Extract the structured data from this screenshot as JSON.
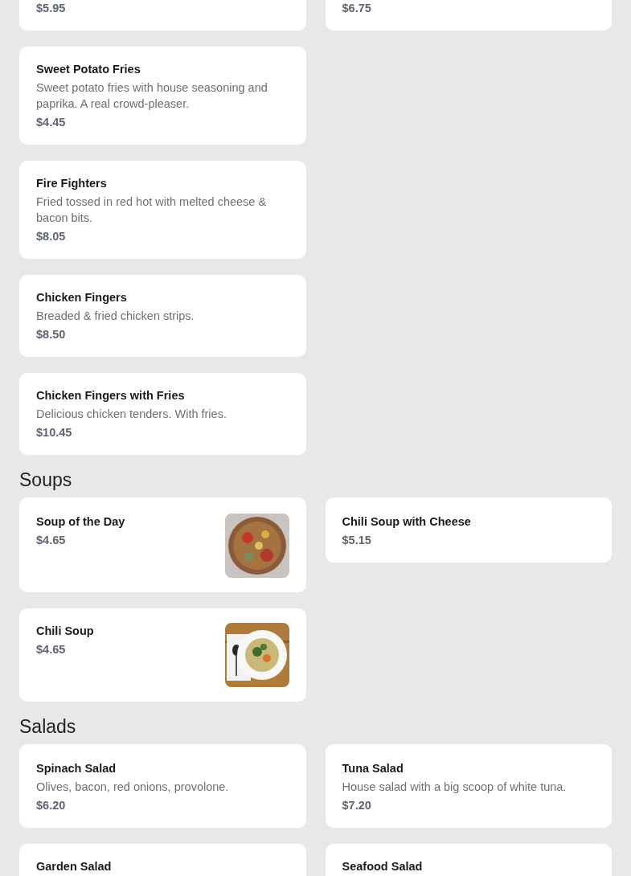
{
  "sections": [
    {
      "items_left": [
        {
          "price": "$5.95"
        },
        {
          "name": "Sweet Potato Fries",
          "description": "Sweet potato fries with house seasoning and paprika. A real crowd-pleaser.",
          "price": "$4.45"
        },
        {
          "name": "Fire Fighters",
          "description": "Fried tossed in red hot with melted cheese & bacon bits.",
          "price": "$8.05"
        },
        {
          "name": "Chicken Fingers",
          "description": "Breaded & fried chicken strips.",
          "price": "$8.50"
        },
        {
          "name": "Chicken Fingers with Fries",
          "description": "Delicious chicken tenders. With fries.",
          "price": "$10.45"
        }
      ],
      "items_right": [
        {
          "price": "$6.75"
        }
      ]
    },
    {
      "title": "Soups",
      "items_left": [
        {
          "name": "Soup of the Day",
          "price": "$4.65"
        },
        {
          "name": "Chili Soup",
          "price": "$4.65"
        }
      ],
      "items_right": [
        {
          "name": "Chili Soup with Cheese",
          "price": "$5.15"
        }
      ]
    },
    {
      "title": "Salads",
      "items_left": [
        {
          "name": "Spinach Salad",
          "description": "Olives, bacon, red onions, provolone.",
          "price": "$6.20"
        },
        {
          "name": "Garden Salad"
        }
      ],
      "items_right": [
        {
          "name": "Tuna Salad",
          "description": "House salad with a big scoop of white tuna.",
          "price": "$7.20"
        },
        {
          "name": "Seafood Salad"
        }
      ]
    }
  ]
}
